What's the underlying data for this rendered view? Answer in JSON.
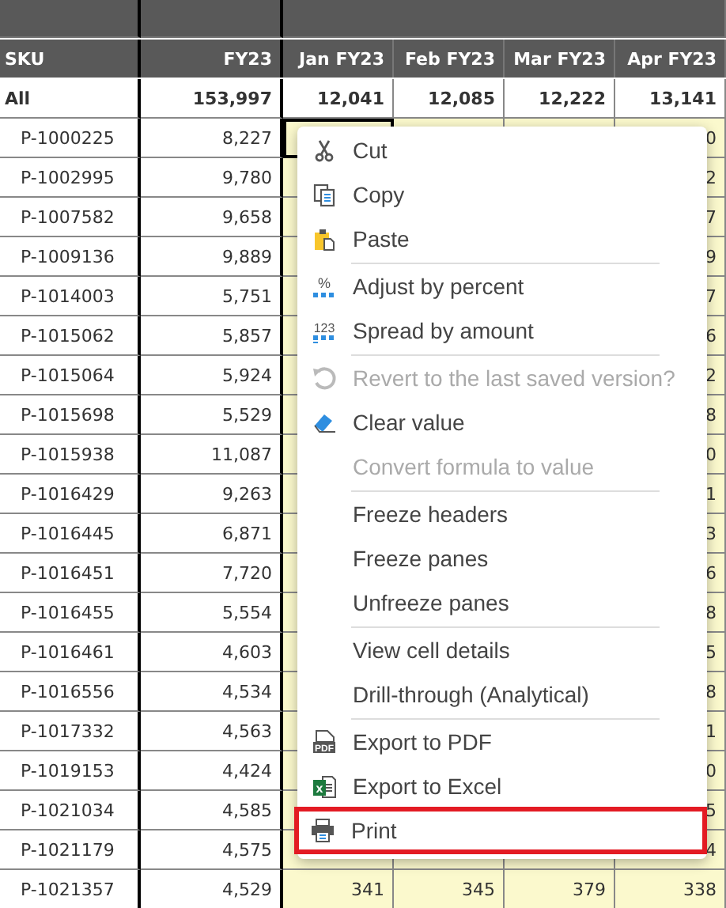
{
  "table": {
    "columns": [
      "SKU",
      "FY23",
      "Jan FY23",
      "Feb FY23",
      "Mar FY23",
      "Apr FY23"
    ],
    "total": {
      "label": "All",
      "fy23": "153,997",
      "months": [
        "12,041",
        "12,085",
        "12,222",
        "13,141"
      ]
    },
    "rows": [
      {
        "sku": "P-1000225",
        "fy23": "8,227",
        "selected": true,
        "apr_tail": "0"
      },
      {
        "sku": "P-1002995",
        "fy23": "9,780",
        "selected": false,
        "apr_tail": "2"
      },
      {
        "sku": "P-1007582",
        "fy23": "9,658",
        "selected": false,
        "apr_tail": "7"
      },
      {
        "sku": "P-1009136",
        "fy23": "9,889",
        "selected": false,
        "apr_tail": "9"
      },
      {
        "sku": "P-1014003",
        "fy23": "5,751",
        "selected": false,
        "apr_tail": "7"
      },
      {
        "sku": "P-1015062",
        "fy23": "5,857",
        "selected": false,
        "apr_tail": "6"
      },
      {
        "sku": "P-1015064",
        "fy23": "5,924",
        "selected": false,
        "apr_tail": "2"
      },
      {
        "sku": "P-1015698",
        "fy23": "5,529",
        "selected": false,
        "apr_tail": "8"
      },
      {
        "sku": "P-1015938",
        "fy23": "11,087",
        "selected": false,
        "apr_tail": "0"
      },
      {
        "sku": "P-1016429",
        "fy23": "9,263",
        "selected": false,
        "apr_tail": "1"
      },
      {
        "sku": "P-1016445",
        "fy23": "6,871",
        "selected": false,
        "apr_tail": "3"
      },
      {
        "sku": "P-1016451",
        "fy23": "7,720",
        "selected": false,
        "apr_tail": "6"
      },
      {
        "sku": "P-1016455",
        "fy23": "5,554",
        "selected": false,
        "apr_tail": "8"
      },
      {
        "sku": "P-1016461",
        "fy23": "4,603",
        "selected": false,
        "apr_tail": "5"
      },
      {
        "sku": "P-1016556",
        "fy23": "4,534",
        "selected": false,
        "apr_tail": "8"
      },
      {
        "sku": "P-1017332",
        "fy23": "4,563",
        "selected": false,
        "apr_tail": "1"
      },
      {
        "sku": "P-1019153",
        "fy23": "4,424",
        "selected": false,
        "apr_tail": "0"
      },
      {
        "sku": "P-1021034",
        "fy23": "4,585",
        "selected": false,
        "apr_tail": "5"
      },
      {
        "sku": "P-1021179",
        "fy23": "4,575",
        "selected": false,
        "apr_tail": "4"
      },
      {
        "sku": "P-1021357",
        "fy23": "4,529",
        "selected": false,
        "months": [
          "341",
          "345",
          "379",
          "338"
        ]
      }
    ]
  },
  "menu": {
    "items": [
      {
        "kind": "item",
        "label": "Cut",
        "disabled": false,
        "highlighted": false
      },
      {
        "kind": "item",
        "label": "Copy",
        "disabled": false,
        "highlighted": false
      },
      {
        "kind": "item",
        "label": "Paste",
        "disabled": false,
        "highlighted": false
      },
      {
        "kind": "separator"
      },
      {
        "kind": "item",
        "label": "Adjust by percent",
        "disabled": false,
        "highlighted": false,
        "icon_text": "%"
      },
      {
        "kind": "item",
        "label": "Spread by amount",
        "disabled": false,
        "highlighted": false,
        "icon_text": "123"
      },
      {
        "kind": "separator"
      },
      {
        "kind": "item",
        "label": "Revert to the last saved version?",
        "disabled": true,
        "highlighted": false
      },
      {
        "kind": "item",
        "label": "Clear value",
        "disabled": false,
        "highlighted": false
      },
      {
        "kind": "item",
        "label": "Convert formula to value",
        "disabled": true,
        "highlighted": false
      },
      {
        "kind": "separator"
      },
      {
        "kind": "item",
        "label": "Freeze headers",
        "disabled": false,
        "highlighted": false
      },
      {
        "kind": "item",
        "label": "Freeze panes",
        "disabled": false,
        "highlighted": false
      },
      {
        "kind": "item",
        "label": "Unfreeze panes",
        "disabled": false,
        "highlighted": false
      },
      {
        "kind": "separator"
      },
      {
        "kind": "item",
        "label": "View cell details",
        "disabled": false,
        "highlighted": false
      },
      {
        "kind": "item",
        "label": "Drill-through (Analytical)",
        "disabled": false,
        "highlighted": false
      },
      {
        "kind": "separator"
      },
      {
        "kind": "item",
        "label": "Export to PDF",
        "disabled": false,
        "highlighted": false,
        "icon_text": "PDF"
      },
      {
        "kind": "item",
        "label": "Export to Excel",
        "disabled": false,
        "highlighted": false,
        "icon_text": "x"
      },
      {
        "kind": "item",
        "label": "Print",
        "disabled": false,
        "highlighted": true
      }
    ]
  }
}
